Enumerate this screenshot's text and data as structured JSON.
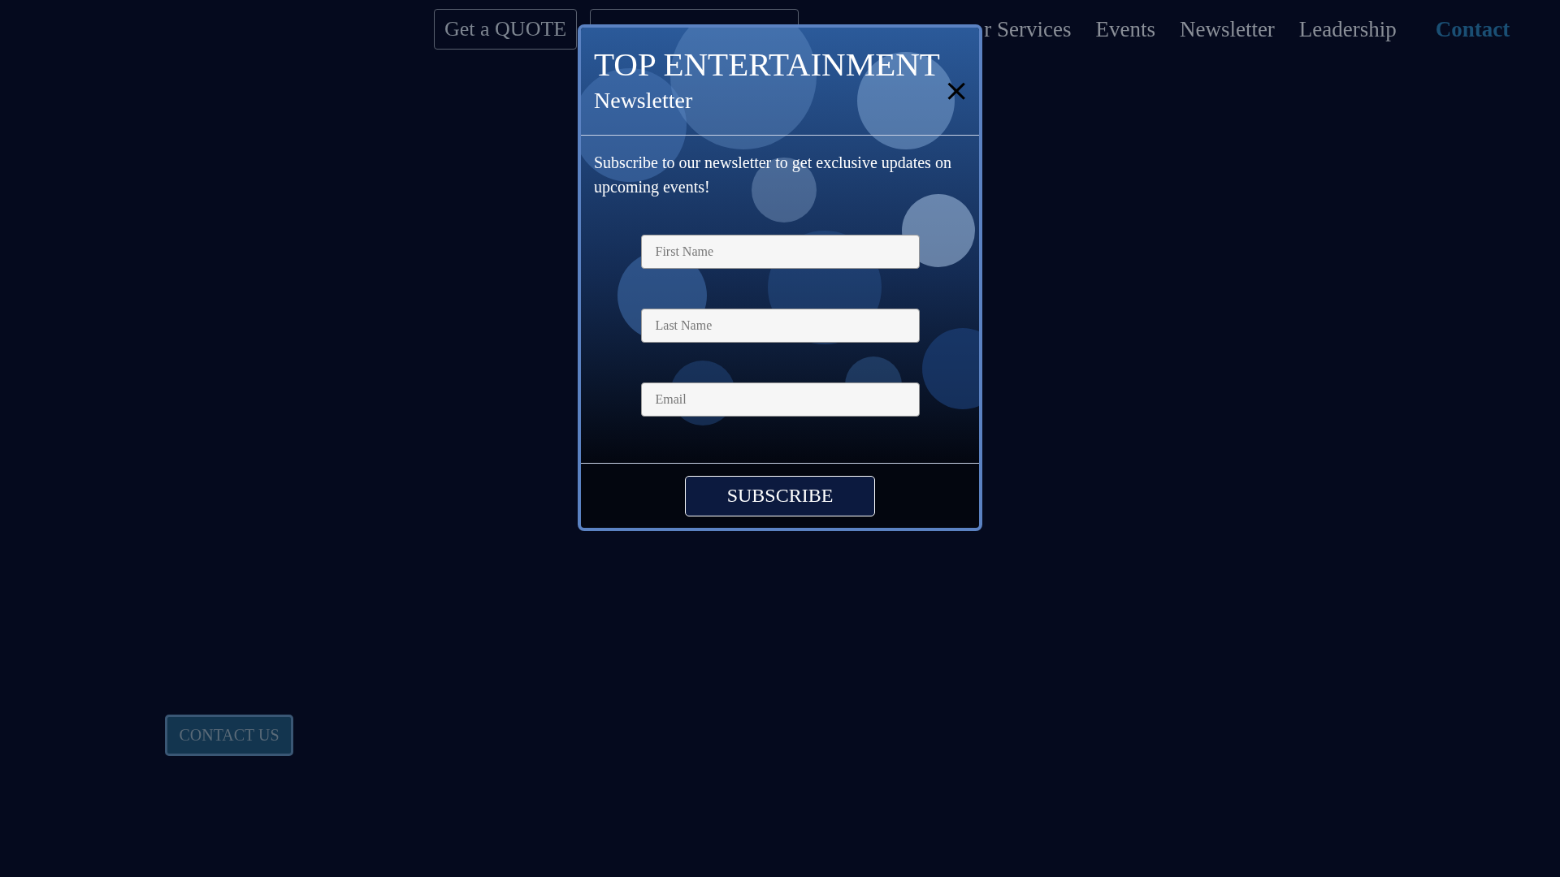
{
  "nav": {
    "buttons": [
      {
        "kind": "labeled",
        "label": "Get a QUOTE"
      },
      {
        "kind": "blank"
      }
    ],
    "links": [
      {
        "label": "r Services",
        "selected": false
      },
      {
        "label": "Events",
        "selected": false
      },
      {
        "label": "Newsletter",
        "selected": false
      },
      {
        "label": "Leadership",
        "selected": false
      },
      {
        "label": "Contact",
        "selected": true
      }
    ]
  },
  "modal": {
    "title": "TOP ENTERTAINMENT",
    "subtitle": "Newsletter",
    "close": "×",
    "text": "Subscribe to our newsletter to get exclusive updates on upcoming events!",
    "fields": [
      {
        "placeholder": "First Name"
      },
      {
        "placeholder": "Last Name"
      },
      {
        "placeholder": "Email"
      }
    ],
    "submit": "SUBSCRIBE"
  },
  "contact_button": "CONTACT US"
}
